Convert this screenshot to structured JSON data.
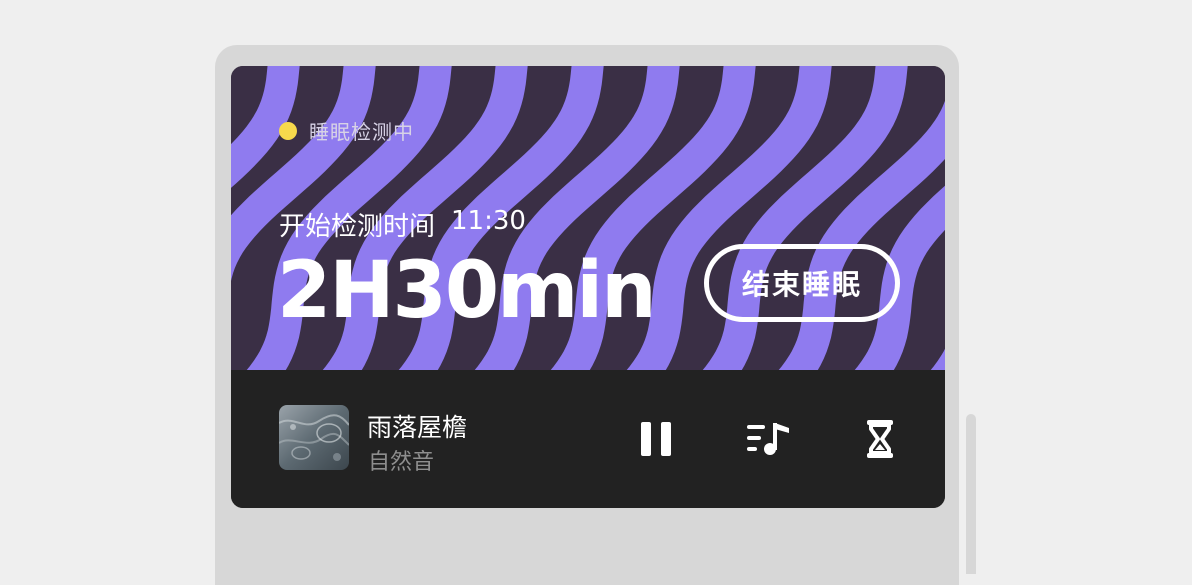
{
  "sleep_card": {
    "status_label": "睡眠检测中",
    "status_color": "#f7d94c",
    "start_label": "开始检测时间",
    "start_time": "11:30",
    "duration": "2H30min",
    "end_button_label": "结束睡眠",
    "wave_colors": {
      "stripe": "#8f7bef",
      "background": "#3a2f45"
    }
  },
  "player": {
    "cover_icon": "rain-artwork",
    "title": "雨落屋檐",
    "subtitle": "自然音",
    "controls": [
      "pause-icon",
      "playlist-icon",
      "hourglass-icon"
    ]
  }
}
